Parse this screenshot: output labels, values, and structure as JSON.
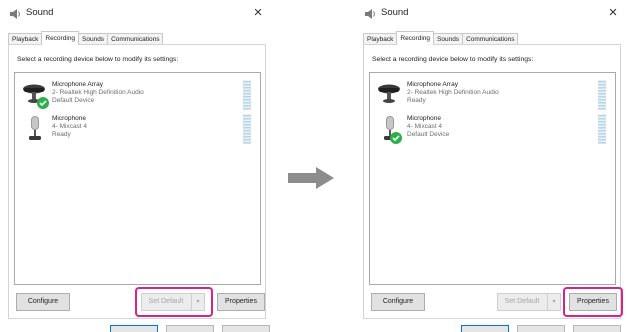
{
  "colors": {
    "accent": "#0078d7",
    "highlight": "#d4238c",
    "check": "#2eaf4b",
    "arrow": "#8c8c8c"
  },
  "icons": [
    "speaker-icon",
    "close-icon",
    "microphone-array-icon",
    "microphone-icon",
    "green-check-icon",
    "level-meter",
    "dropdown-arrow-icon",
    "right-arrow-icon"
  ],
  "before": {
    "title": "Sound",
    "close": "×",
    "tabs": [
      "Playback",
      "Recording",
      "Sounds",
      "Communications"
    ],
    "active_tab": "Recording",
    "instruction": "Select a recording device below to modify its settings:",
    "devices": [
      {
        "name": "Microphone Array",
        "line2": "2- Realtek High Definition Audio",
        "status": "Default Device",
        "default": true
      },
      {
        "name": "Microphone",
        "line2": "4- Mixcast 4",
        "status": "Ready",
        "default": false
      }
    ],
    "buttons": {
      "configure": "Configure",
      "set_default": "Set Default",
      "set_default_arrow": "▾",
      "properties": "Properties"
    },
    "highlighted": "set-default"
  },
  "after": {
    "title": "Sound",
    "close": "×",
    "tabs": [
      "Playback",
      "Recording",
      "Sounds",
      "Communications"
    ],
    "active_tab": "Recording",
    "instruction": "Select a recording device below to modify its settings:",
    "devices": [
      {
        "name": "Microphone Array",
        "line2": "2- Realtek High Definition Audio",
        "status": "Ready",
        "default": false
      },
      {
        "name": "Microphone",
        "line2": "4- Mixcast 4",
        "status": "Default Device",
        "default": true
      }
    ],
    "buttons": {
      "configure": "Configure",
      "set_default": "Set Default",
      "set_default_arrow": "▾",
      "properties": "Properties"
    },
    "highlighted": "properties"
  }
}
